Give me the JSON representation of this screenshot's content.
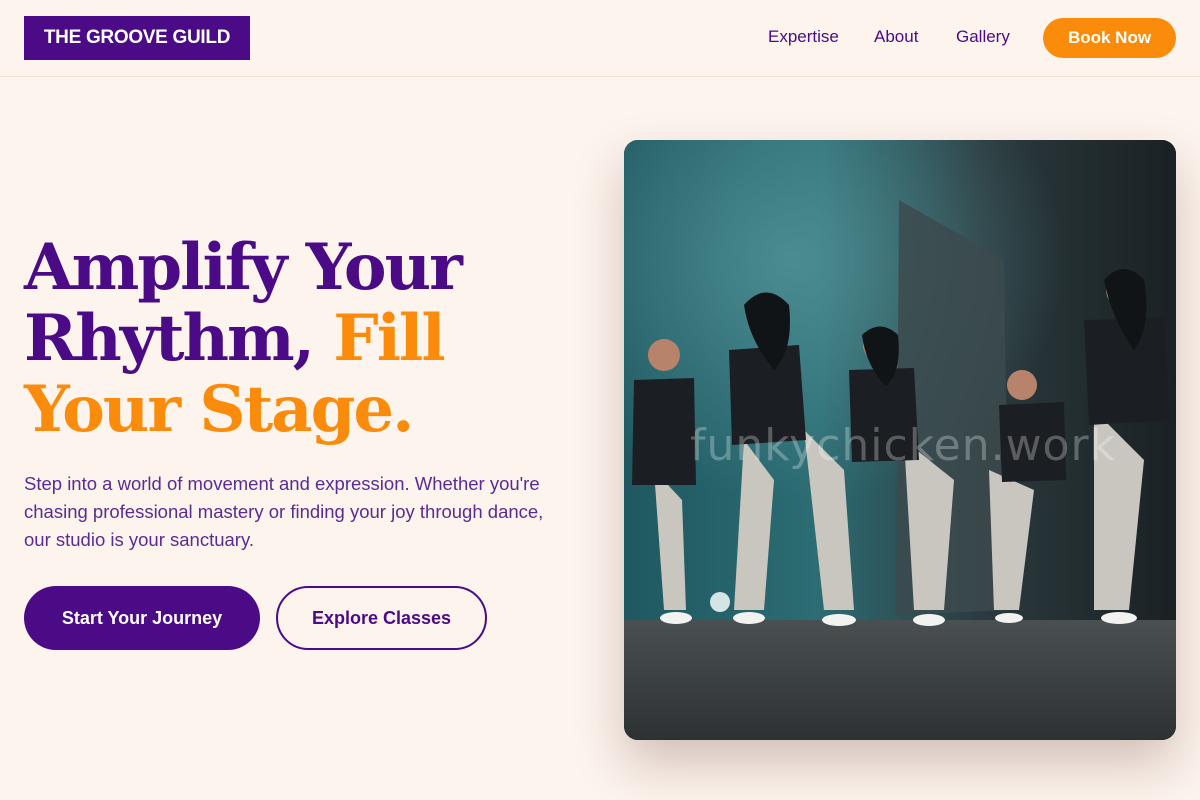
{
  "brand": {
    "logo_text": "THE GROOVE GUILD"
  },
  "nav": {
    "links": [
      "Expertise",
      "About",
      "Gallery"
    ],
    "cta_label": "Book Now"
  },
  "hero": {
    "headline_part1": "Amplify Your Rhythm, ",
    "headline_part2": "Fill Your Stage.",
    "description": "Step into a world of movement and expression. Whether you're chasing professional mastery or finding your joy through dance, our studio is your sanctuary.",
    "primary_button": "Start Your Journey",
    "secondary_button": "Explore Classes",
    "image_watermark": "funkychicken.work"
  },
  "colors": {
    "background": "#fdf4ee",
    "brand_purple": "#4b0a86",
    "accent_orange": "#fb8c0b"
  }
}
